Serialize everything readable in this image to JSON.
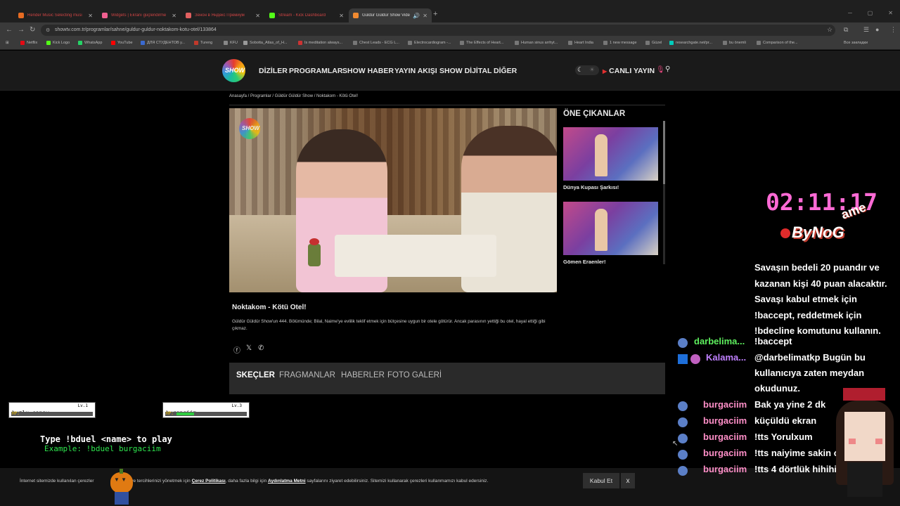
{
  "tabs": [
    {
      "title": "Render Music Selecting musi",
      "color": "#e66b22"
    },
    {
      "title": "Widgets | Ekranı güçlendirme",
      "color": "#f06090"
    },
    {
      "title": "Зенон в Яндекс Премиум",
      "color": "#e06060"
    },
    {
      "title": "Stream - Kick Dashboard",
      "color": "#53fc18"
    },
    {
      "title": "Güldür Güldür Show Video",
      "color": "#f08a30"
    }
  ],
  "url": "showtv.com.tr/programlar/sahne/guldur-guldur-noktakom-kotu-otel/133864",
  "bookmarks": [
    "Netflix",
    "Kick Logo",
    "WhatsApp",
    "YouTube",
    "ДЛЯ СТУДЕНТОВ у...",
    "Tureng",
    "KFU",
    "Sobotta_Atlas_of_H...",
    "Is meditation always...",
    "Chest Leads - ECG L...",
    "Electrocardiogram -...",
    "The Effects of Heart...",
    "Human sinus arrhyt...",
    "Heart India",
    "1 new message",
    "Güzel",
    "researchgate.net/pr...",
    "bu önemli",
    "Comparison of the..."
  ],
  "bookmarks_other": "Все закладки",
  "site": {
    "logo_text": "SHOW",
    "menu": [
      "DİZİLER",
      "PROGRAMLAR",
      "SHOW HABER",
      "YAYIN AKIŞI",
      "SHOW DİJİTAL",
      "DİĞER"
    ],
    "live_label": "CANLI YAYIN"
  },
  "breadcrumb": "Anasayfa / Programlar / Güldür Güldür Show / Noktakom - Kötü Otel!",
  "video": {
    "title": "Noktakom - Kötü Otel!",
    "description": "Güldür Güldür Show'un 444. Bölümünde; Bilal, Naime'ye evlilik teklif etmek için bütçesine uygun bir otele götürür. Ancak parasının yettiği bu otel, hayal ettiği gibi çıkmaz."
  },
  "highlights": {
    "title": "ÖNE ÇIKANLAR",
    "items": [
      {
        "title": "Dünya Kupası Şarkısı!"
      },
      {
        "title": "Gömen Eraenler!"
      }
    ]
  },
  "content_tabs": [
    "SKEÇLER",
    "FRAGMANLAR",
    "HABERLER",
    "FOTO GALERİ"
  ],
  "cookie": {
    "text_1": "İnternet sitemizde kullanılan çerezler ",
    "text_2": " olmak ve tercihlerinizi yönetmek için ",
    "policy_link": "Çerez Politikası",
    "text_3": ", daha fazla bilgi için ",
    "notice_link": "Aydınlatma Metni",
    "text_4": " sayfalarını ziyaret edebilirsiniz. Sitemizi kullanarak çerezleri kullanmamızı kabul edersiniz.",
    "accept": "Kabul Et",
    "close": "x"
  },
  "game": {
    "players": [
      {
        "name": "buzlu_canav",
        "level": "Lv.1",
        "hp_label": "HP:",
        "hp_fraction": 0.0
      },
      {
        "name": "burgaciim",
        "level": "Lv.3",
        "hp_label": "HP:",
        "hp_fraction": 0.26
      }
    ],
    "instruction": "Type !bduel <name> to play",
    "example": "Example: !bduel burgaciim"
  },
  "stream": {
    "timer": "02:11:17",
    "brand": "ByNoG",
    "brand_game": "ame",
    "bot_message": "Savaşın bedeli 20 puandır ve kazanan kişi 40 puan alacaktır. Savaşı kabul etmek için !baccept, reddetmek için !bdecline komutunu kullanın.",
    "chat": [
      {
        "user": "darbelima...",
        "color": "#5ef05e",
        "msg": "!baccept"
      },
      {
        "user": "Kalama...",
        "color": "#c080ff",
        "msg": "@darbelimatkp Bugün bu"
      },
      {
        "user": "",
        "color": "#fff",
        "msg": "kullanıcıya zaten meydan"
      },
      {
        "user": "",
        "color": "#fff",
        "msg": "okudunuz."
      },
      {
        "user": "burgaciim",
        "color": "#ff8fc8",
        "msg": "Bak ya yine 2 dk"
      },
      {
        "user": "burgaciim",
        "color": "#ff8fc8",
        "msg": "küçüldü ekran"
      },
      {
        "user": "burgaciim",
        "color": "#ff8fc8",
        "msg": "!tts Yorulxum"
      },
      {
        "user": "burgaciim",
        "color": "#ff8fc8",
        "msg": "!tts naiyime sakin ol"
      },
      {
        "user": "burgaciim",
        "color": "#ff8fc8",
        "msg": "!tts 4 dörtlük hihihihi"
      }
    ]
  }
}
